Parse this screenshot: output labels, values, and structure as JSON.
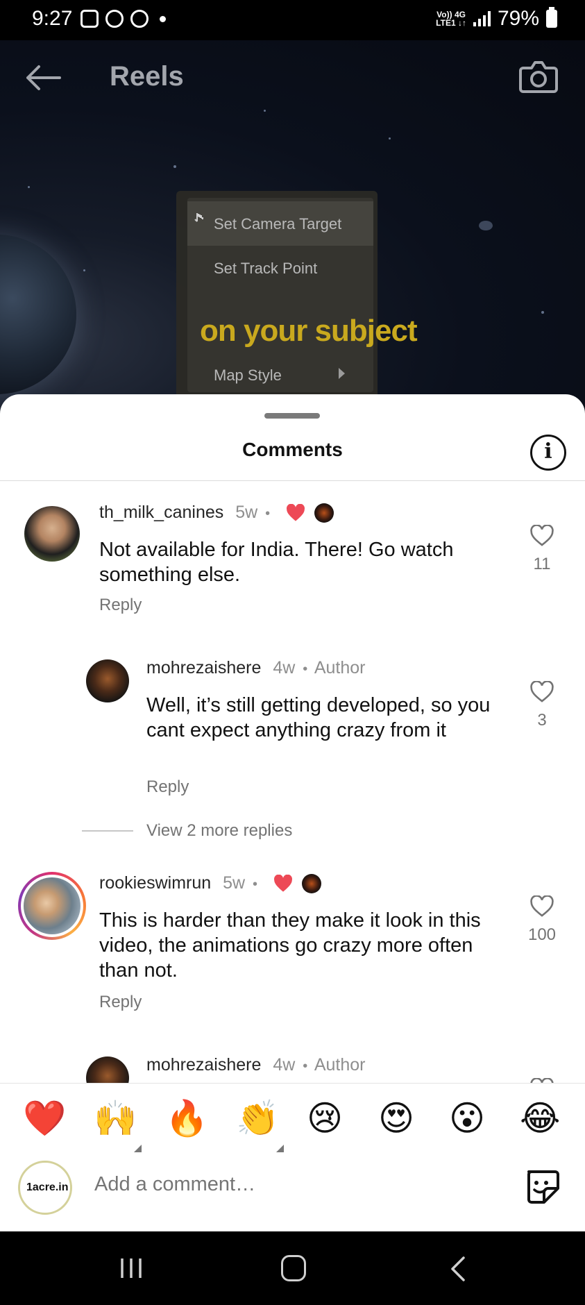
{
  "status_bar": {
    "time": "9:27",
    "network_top": "Vo)) 4G",
    "network_bottom": "LTE1 ↓↑",
    "battery": "79%"
  },
  "top_bar": {
    "back_icon": "arrow-left-icon",
    "title": "Reels",
    "camera_icon": "camera-icon"
  },
  "video": {
    "menu_items": [
      "Set Camera Target",
      "Set Track Point",
      "Map Style"
    ],
    "caption": "on your subject"
  },
  "sheet": {
    "title": "Comments",
    "info_icon": "info-icon",
    "info_label": "i"
  },
  "comments": [
    {
      "username": "th_milk_canines",
      "age": "5w",
      "text": "Not available for India. There! Go watch something else.",
      "reply": "Reply",
      "likes": "11",
      "creator_liked": true
    },
    {
      "username": "mohrezaishere",
      "age": "4w",
      "tag": "Author",
      "text": "Well, it’s still getting developed, so you cant expect anything crazy from it",
      "reply": "Reply",
      "likes": "3"
    },
    {
      "username": "rookieswimrun",
      "age": "5w",
      "text": "This is harder than they make it look in this video, the animations go crazy more often than not.",
      "reply": "Reply",
      "likes": "100",
      "creator_liked": true
    },
    {
      "username": "mohrezaishere",
      "age": "4w",
      "tag": "Author"
    }
  ],
  "view_more_replies": "View 2 more replies",
  "separator": "•",
  "emoji_reactions": [
    "❤️",
    "🙌",
    "🔥",
    "👏",
    "😢",
    "😍",
    "😮",
    "😂"
  ],
  "composer": {
    "avatar_text": "1acre.in",
    "placeholder": "Add a comment…",
    "sticker_icon": "sticker-icon"
  },
  "colors": {
    "heart_red": "#ed4956",
    "muted_text": "#737373",
    "caption_gold": "#c9a91e"
  }
}
